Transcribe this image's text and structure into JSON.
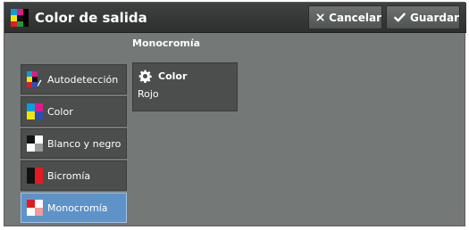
{
  "header": {
    "title": "Color de salida",
    "cancel_label": "Cancelar",
    "save_label": "Guardar",
    "icon": "color-output-icon"
  },
  "sidebar": {
    "items": [
      {
        "label": "Autodetección",
        "icon": "autodetect-icon",
        "selected": false
      },
      {
        "label": "Color",
        "icon": "full-color-icon",
        "selected": false
      },
      {
        "label": "Blanco y negro",
        "icon": "black-white-icon",
        "selected": false
      },
      {
        "label": "Bicromía",
        "icon": "two-color-icon",
        "selected": false
      },
      {
        "label": "Monocromía",
        "icon": "single-color-icon",
        "selected": true
      }
    ]
  },
  "main": {
    "section_label": "Monocromía",
    "color_setting": {
      "label": "Color",
      "value": "Rojo",
      "icon": "gear-icon"
    }
  },
  "colors": {
    "background": "#747876",
    "header": "#353837",
    "tab": "#4b4e4c",
    "selected_tab": "#5e93c8",
    "red": "#e21b22",
    "yellow": "#f4e500",
    "magenta": "#e2178a",
    "cyan": "#00a0e3"
  }
}
